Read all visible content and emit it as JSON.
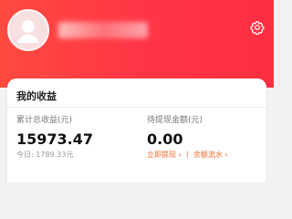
{
  "header": {
    "brand_color": "#ff3447"
  },
  "card": {
    "title": "我的收益",
    "left": {
      "label": "累计总收益(元)",
      "amount": "15973.47",
      "today_label": "今日:",
      "today_value": "1789.33元"
    },
    "right": {
      "label": "待提现金额(元)",
      "amount": "0.00",
      "withdraw_label": "立即提现",
      "flow_label": "余额流水",
      "separator": "丨",
      "chevron": "›"
    }
  },
  "icons": {
    "avatar": "avatar-icon",
    "settings": "gear-icon"
  }
}
